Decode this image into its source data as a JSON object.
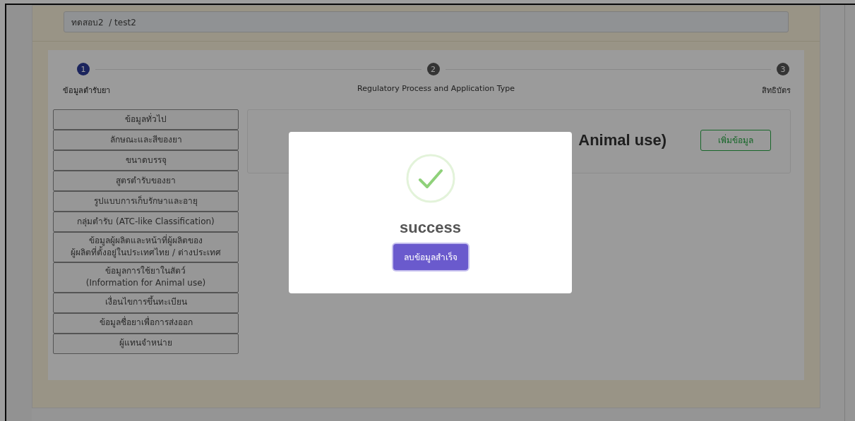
{
  "field": {
    "value": "ทดสอบ2  / test2"
  },
  "steps": [
    {
      "number": "1",
      "label": "ข้อมูลตำรับยา",
      "selected": true
    },
    {
      "number": "2",
      "label": "Regulatory Process and Application Type",
      "selected": false
    },
    {
      "number": "3",
      "label": "สิทธิบัตร",
      "selected": false
    }
  ],
  "sidebar": {
    "items": [
      "ข้อมูลทั่วไป",
      "ลักษณะและสีของยา",
      "ขนาดบรรจุ",
      "สูตรตำรับของยา",
      "รูปแบบการเก็บรักษาและอายุ",
      "กลุ่มตำรับ (ATC-like Classification)",
      "ข้อมูลผู้ผลิตและหน้าที่ผู้ผลิตของ\nผู้ผลิตที่ตั้งอยู่ในประเทศไทย / ต่างประเทศ",
      "ข้อมูลการใช้ยาในสัตว์\n(Information for Animal use)",
      "เงื่อนไขการขึ้นทะเบียน",
      "ข้อมูลชื่อยาเพื่อการส่งออก",
      "ผู้แทนจำหน่าย"
    ]
  },
  "content": {
    "heading": "Animal use)",
    "add_button": "เพิ่มข้อมูล"
  },
  "modal": {
    "title": "success",
    "button": "ลบข้อมูลสำเร็จ"
  }
}
